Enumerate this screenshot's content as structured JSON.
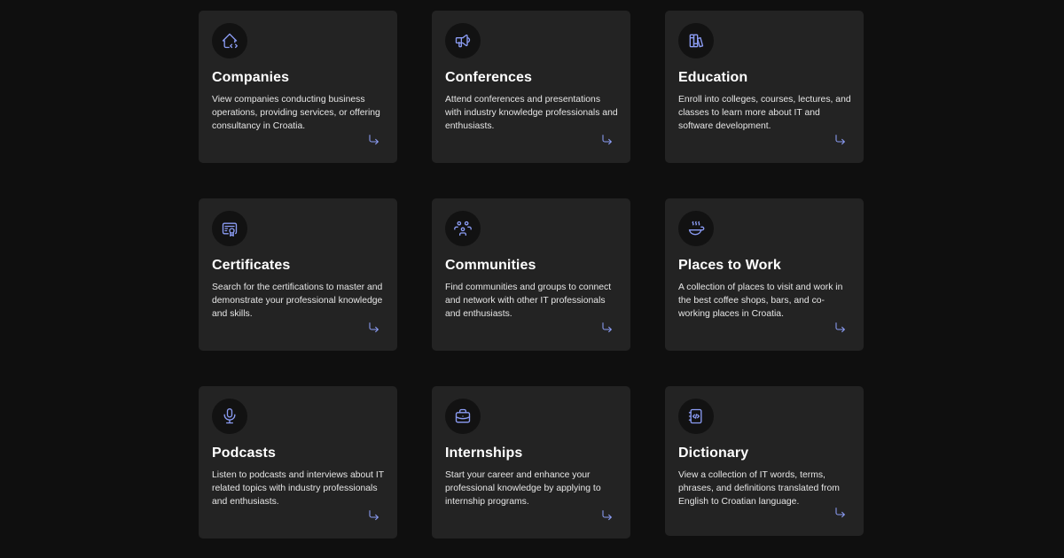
{
  "cards": [
    {
      "title": "Companies",
      "description": "View companies conducting business operations, providing services, or offering consultancy in Croatia.",
      "icon": "home-code-icon"
    },
    {
      "title": "Conferences",
      "description": "Attend conferences and presentations with industry knowledge professionals and enthusiasts.",
      "icon": "megaphone-icon"
    },
    {
      "title": "Education",
      "description": "Enroll into colleges, courses, lectures, and classes to learn more about IT and software development.",
      "icon": "books-icon"
    },
    {
      "title": "Certificates",
      "description": "Search for the certifications to master and demonstrate your professional knowledge and skills.",
      "icon": "certificate-icon"
    },
    {
      "title": "Communities",
      "description": "Find communities and groups to connect and network with other IT professionals and enthusiasts.",
      "icon": "users-group-icon"
    },
    {
      "title": "Places to Work",
      "description": "A collection of places to visit and work in the best coffee shops, bars, and co-working places in Croatia.",
      "icon": "coffee-icon"
    },
    {
      "title": "Podcasts",
      "description": "Listen to podcasts and interviews about IT related topics with industry professionals and enthusiasts.",
      "icon": "microphone-icon"
    },
    {
      "title": "Internships",
      "description": "Start your career and enhance your professional knowledge by applying to internship programs.",
      "icon": "briefcase-icon"
    },
    {
      "title": "Dictionary",
      "description": "View a collection of IT words, terms, phrases, and definitions translated from English to Croatian language.",
      "icon": "code-book-icon"
    }
  ],
  "colors": {
    "background": "#0f0f0f",
    "card": "#232323",
    "icon_bg": "#121212",
    "accent": "#8b9cf4"
  }
}
